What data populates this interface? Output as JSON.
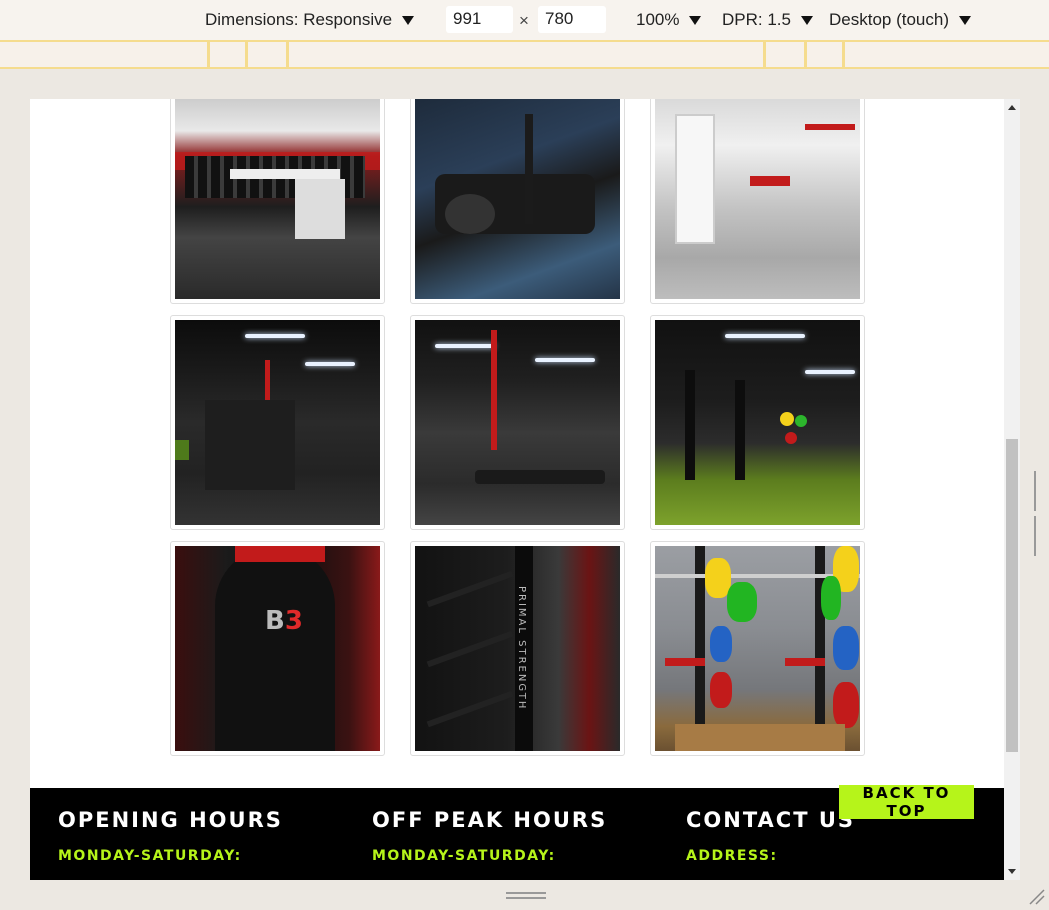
{
  "devtools": {
    "dimensions_label": "Dimensions: Responsive",
    "width": "991",
    "times": "×",
    "height": "780",
    "zoom": "100%",
    "dpr": "DPR: 1.5",
    "device_mode": "Desktop (touch)"
  },
  "gallery": {
    "tiles": [
      {
        "photo": "dumbbell-rack"
      },
      {
        "photo": "elliptical-trainer"
      },
      {
        "photo": "cable-machine"
      },
      {
        "photo": "strength-machine"
      },
      {
        "photo": "adjustable-bench"
      },
      {
        "photo": "power-rack-turf"
      },
      {
        "photo": "punch-bag"
      },
      {
        "photo": "primal-strength-rack"
      },
      {
        "photo": "weight-plates-rack"
      }
    ]
  },
  "footer": {
    "col1": {
      "title": "OPENING HOURS",
      "sub": "MONDAY-SATURDAY:"
    },
    "col2": {
      "title": "OFF PEAK HOURS",
      "sub": "MONDAY-SATURDAY:"
    },
    "col3": {
      "title": "CONTACT US",
      "sub": "ADDRESS:"
    },
    "back_to_top": "BACK TO TOP"
  },
  "colors": {
    "accent": "#b6f41a",
    "footer_bg": "#000000",
    "toolbar_bg": "#f7f3ee"
  }
}
